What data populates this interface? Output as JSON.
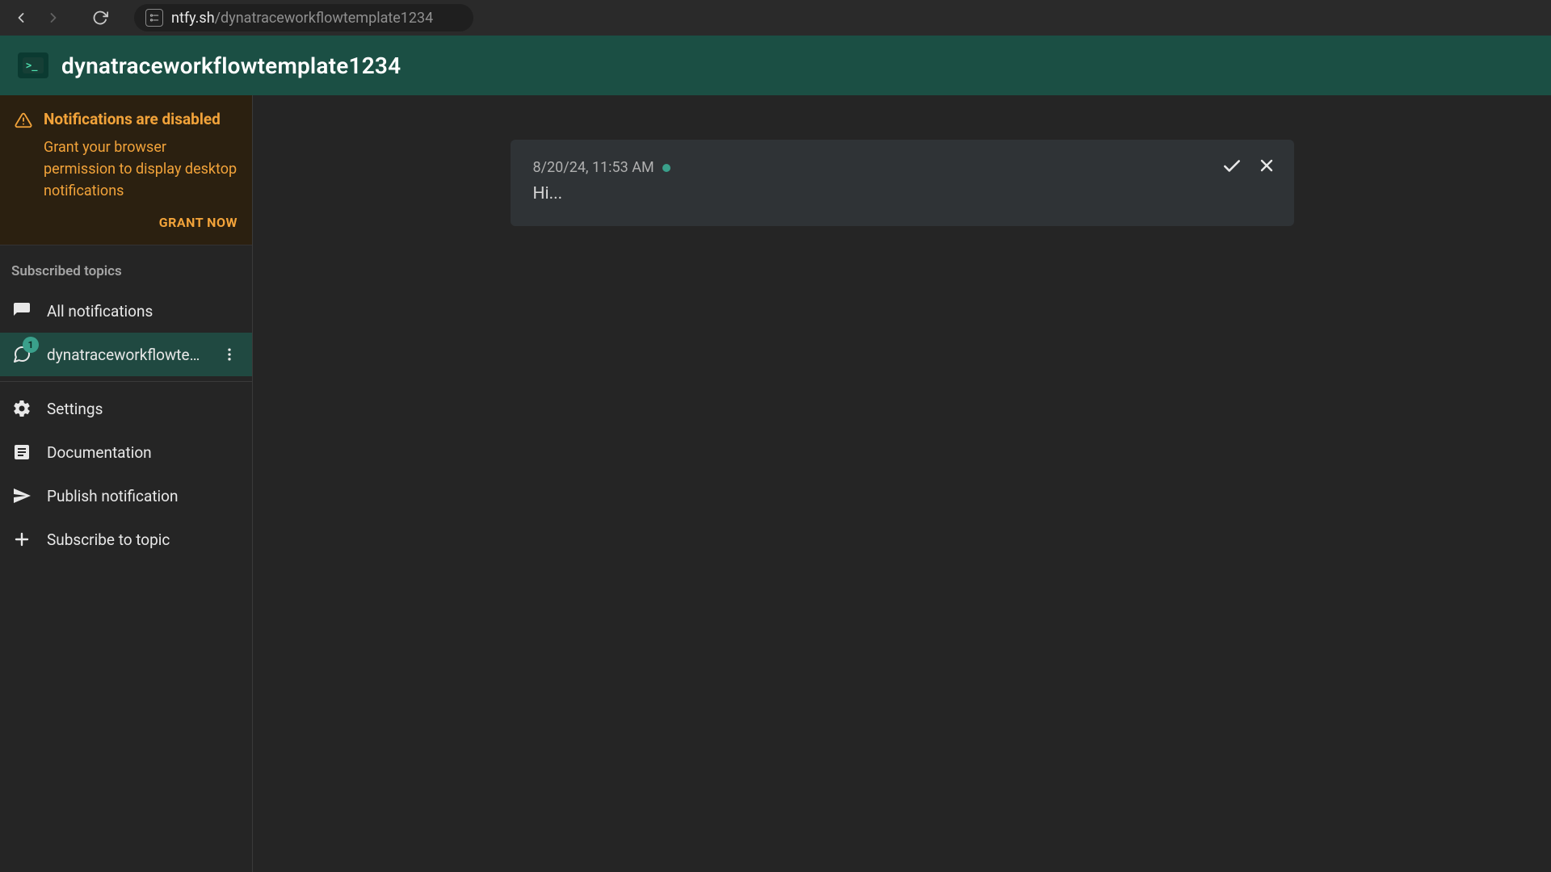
{
  "browser": {
    "url_host": "ntfy.sh",
    "url_path": "/dynatraceworkflowtemplate1234"
  },
  "header": {
    "title": "dynatraceworkflowtemplate1234"
  },
  "sidebar": {
    "warning": {
      "title": "Notifications are disabled",
      "desc": "Grant your browser permission to display desktop notifications",
      "action": "GRANT NOW"
    },
    "section_label": "Subscribed topics",
    "all_notifications": "All notifications",
    "topic": {
      "label": "dynatraceworkflowtem…",
      "badge": "1"
    },
    "links": {
      "settings": "Settings",
      "documentation": "Documentation",
      "publish": "Publish notification",
      "subscribe": "Subscribe to topic"
    }
  },
  "notification": {
    "timestamp": "8/20/24, 11:53 AM",
    "message": "Hi..."
  }
}
